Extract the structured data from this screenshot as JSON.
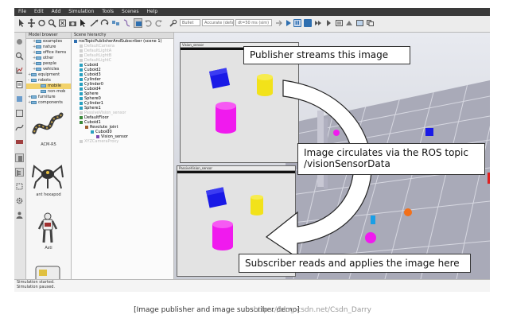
{
  "menu": [
    "File",
    "Edit",
    "Add",
    "Simulation",
    "Tools",
    "Scenes",
    "Help"
  ],
  "toolbar": {
    "select1": "Bullet",
    "select2": "Accurate (default)",
    "select3": "dt=50 ms (sim)"
  },
  "model_browser": {
    "title": "Model browser",
    "items": [
      {
        "label": "examples",
        "indent": 1,
        "pm": "+"
      },
      {
        "label": "nature",
        "indent": 1,
        "pm": "+"
      },
      {
        "label": "office items",
        "indent": 1,
        "pm": "+"
      },
      {
        "label": "other",
        "indent": 1,
        "pm": "+"
      },
      {
        "label": "people",
        "indent": 1,
        "pm": "+"
      },
      {
        "label": "vehicles",
        "indent": 1,
        "pm": "+"
      },
      {
        "label": "equipment",
        "indent": 0,
        "pm": "+"
      },
      {
        "label": "robots",
        "indent": 0,
        "pm": "-"
      },
      {
        "label": "mobile",
        "indent": 2,
        "pm": "",
        "selected": true
      },
      {
        "label": "non-mob",
        "indent": 2,
        "pm": ""
      },
      {
        "label": "furniture",
        "indent": 0,
        "pm": "+"
      },
      {
        "label": "components",
        "indent": 0,
        "pm": "+"
      }
    ],
    "thumbnails": [
      "ACM-R5",
      "ant hexapod",
      "Asti",
      ""
    ]
  },
  "scene_hierarchy": {
    "title": "Scene hierarchy",
    "rows": [
      {
        "label": "rosTopicPublisherAndSubscriber (scene 1)",
        "indent": 0,
        "type": "scene"
      },
      {
        "label": "DefaultCamera",
        "indent": 1,
        "type": "dis"
      },
      {
        "label": "DefaultLightA",
        "indent": 1,
        "type": "dis"
      },
      {
        "label": "DefaultLightB",
        "indent": 1,
        "type": "dis"
      },
      {
        "label": "DefaultLightC",
        "indent": 1,
        "type": "dis"
      },
      {
        "label": "Cuboid",
        "indent": 1,
        "type": "shape"
      },
      {
        "label": "Cuboid2",
        "indent": 1,
        "type": "shape"
      },
      {
        "label": "Cuboid3",
        "indent": 1,
        "type": "shape"
      },
      {
        "label": "Cylinder",
        "indent": 1,
        "type": "shape"
      },
      {
        "label": "Cylinder0",
        "indent": 1,
        "type": "shape"
      },
      {
        "label": "Cuboid4",
        "indent": 1,
        "type": "shape"
      },
      {
        "label": "Sphere",
        "indent": 1,
        "type": "shape"
      },
      {
        "label": "Sphere0",
        "indent": 1,
        "type": "shape"
      },
      {
        "label": "Cylinder1",
        "indent": 1,
        "type": "shape"
      },
      {
        "label": "Sphere1",
        "indent": 1,
        "type": "shape"
      },
      {
        "label": "PassiveVision_sensor",
        "indent": 1,
        "type": "dis"
      },
      {
        "label": "DefaultFloor",
        "indent": 1,
        "type": "pm"
      },
      {
        "label": "Cuboid1",
        "indent": 1,
        "type": "pm"
      },
      {
        "label": "Revolute_joint",
        "indent": 2,
        "type": "joint"
      },
      {
        "label": "Cuboid0",
        "indent": 3,
        "type": "shape"
      },
      {
        "label": "Vision_sensor",
        "indent": 4,
        "type": "sensor"
      },
      {
        "label": "XYZCameraProxy",
        "indent": 1,
        "type": "dis"
      }
    ]
  },
  "vision_top": {
    "title": "Vision_sensor"
  },
  "vision_bottom": {
    "title": "PassiveVision_sensor"
  },
  "callouts": {
    "publisher": "Publisher streams this image",
    "topic_line1": "Image circulates via the ROS topic",
    "topic_line2": "/visionSensorData",
    "subscriber": "Subscriber reads and applies the image here"
  },
  "status": [
    "Simulation started.",
    "Simulation paused."
  ],
  "caption": {
    "text": "[Image publisher and image subscriber demo]",
    "watermark": "https://blog.csdn.net/Csdn_Darry"
  },
  "colors": {
    "blue": "#1a1ae6",
    "yellow": "#f2e21a",
    "magenta": "#f01aee",
    "highlight": "#f2d26a",
    "menubar": "#3a3a3a"
  }
}
